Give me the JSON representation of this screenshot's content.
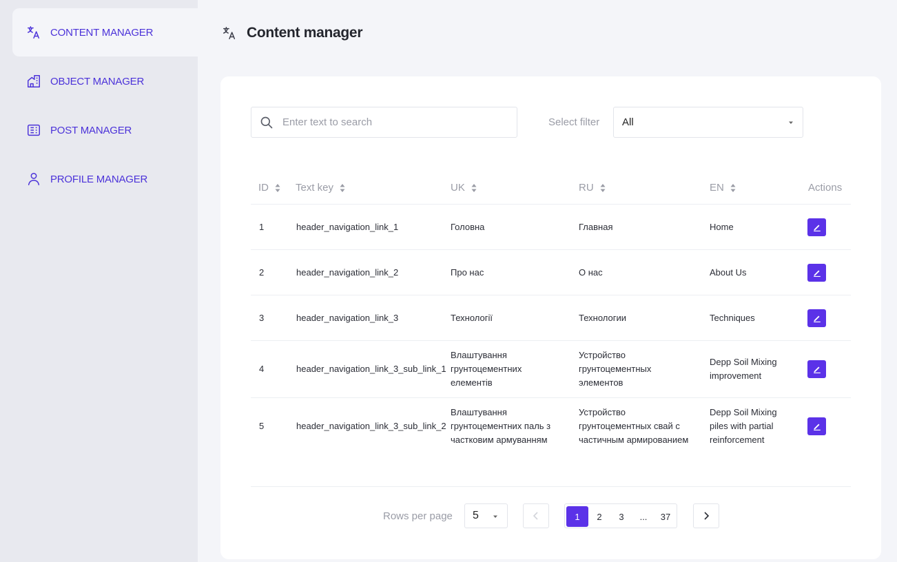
{
  "sidebar": {
    "items": [
      {
        "label": "CONTENT MANAGER",
        "icon": "translate-icon",
        "active": true
      },
      {
        "label": "OBJECT MANAGER",
        "icon": "building-icon",
        "active": false
      },
      {
        "label": "POST MANAGER",
        "icon": "article-icon",
        "active": false
      },
      {
        "label": "PROFILE MANAGER",
        "icon": "user-icon",
        "active": false
      }
    ]
  },
  "header": {
    "title": "Content manager",
    "icon": "translate-icon"
  },
  "search": {
    "placeholder": "Enter text to search",
    "value": ""
  },
  "filter": {
    "label": "Select filter",
    "value": "All"
  },
  "table": {
    "columns": [
      "ID",
      "Text key",
      "UK",
      "RU",
      "EN",
      "Actions"
    ],
    "rows": [
      {
        "id": "1",
        "key": "header_navigation_link_1",
        "uk": [
          "Головна"
        ],
        "ru": [
          "Главная"
        ],
        "en": [
          "Home"
        ]
      },
      {
        "id": "2",
        "key": "header_navigation_link_2",
        "uk": [
          "Про нас"
        ],
        "ru": [
          "О нас"
        ],
        "en": [
          "About Us"
        ]
      },
      {
        "id": "3",
        "key": "header_navigation_link_3",
        "uk": [
          "Технології"
        ],
        "ru": [
          "Технологии"
        ],
        "en": [
          "Techniques"
        ]
      },
      {
        "id": "4",
        "key": "header_navigation_link_3_sub_link_1",
        "uk": [
          "Влаштування",
          "грунтоцементних",
          "елементів"
        ],
        "ru": [
          "Устройство",
          "грунтоцементных",
          "элементов"
        ],
        "en": [
          "Depp Soil Mixing",
          "improvement"
        ]
      },
      {
        "id": "5",
        "key": "header_navigation_link_3_sub_link_2",
        "uk": [
          "Влаштування",
          "грунтоцементних паль з",
          "частковим армуванням"
        ],
        "ru": [
          "Устройство",
          "грунтоцементных свай с",
          "частичным армированием"
        ],
        "en": [
          "Depp Soil Mixing",
          "piles with partial",
          "reinforcement"
        ]
      }
    ]
  },
  "pagination": {
    "rows_label": "Rows per page",
    "rows_value": "5",
    "pages": [
      "1",
      "2",
      "3",
      "...",
      "37"
    ],
    "current": "1"
  },
  "colors": {
    "accent": "#5b32e8",
    "nav_text": "#4b32d9"
  }
}
